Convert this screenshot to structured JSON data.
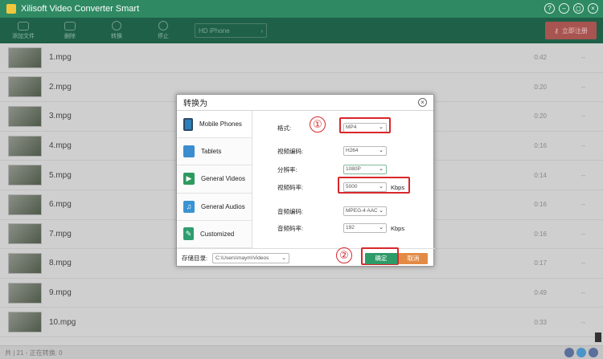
{
  "app": {
    "title": "Xilisoft Video Converter Smart",
    "window_controls": [
      "?",
      "–",
      "◻",
      "×"
    ]
  },
  "toolbar": {
    "buttons": [
      {
        "label": "添加文件",
        "icon": "add-file-icon"
      },
      {
        "label": "删除",
        "icon": "delete-icon"
      },
      {
        "label": "转换",
        "icon": "convert-icon"
      },
      {
        "label": "停止",
        "icon": "stop-icon"
      }
    ],
    "profile": "HD iPhone",
    "register_label": "立即注册"
  },
  "files": [
    {
      "name": "1.mpg",
      "duration": "0:42",
      "dash": "--"
    },
    {
      "name": "2.mpg",
      "duration": "0:20",
      "dash": "--"
    },
    {
      "name": "3.mpg",
      "duration": "0:20",
      "dash": "--"
    },
    {
      "name": "4.mpg",
      "duration": "0:16",
      "dash": "--"
    },
    {
      "name": "5.mpg",
      "duration": "0:14",
      "dash": "--"
    },
    {
      "name": "6.mpg",
      "duration": "0:16",
      "dash": "--"
    },
    {
      "name": "7.mpg",
      "duration": "0:16",
      "dash": "--"
    },
    {
      "name": "8.mpg",
      "duration": "0:17",
      "dash": "--"
    },
    {
      "name": "9.mpg",
      "duration": "0:49",
      "dash": "--"
    },
    {
      "name": "10.mpg",
      "duration": "0:33",
      "dash": "--"
    }
  ],
  "statusbar": {
    "text": "共 | 21 ◦ 正在转换: 0"
  },
  "dialog": {
    "title": "转换为",
    "categories": [
      {
        "label": "Mobile Phones",
        "icon": "mobile-phone-icon"
      },
      {
        "label": "Tablets",
        "icon": "tablet-icon"
      },
      {
        "label": "General Videos",
        "icon": "general-video-icon"
      },
      {
        "label": "General Audios",
        "icon": "music-note-icon"
      },
      {
        "label": "Customized",
        "icon": "customized-icon"
      }
    ],
    "settings": {
      "format_label": "格式:",
      "format_value": "MP4",
      "video_codec_label": "视频编码:",
      "video_codec_value": "H264",
      "resolution_label": "分辨率:",
      "resolution_value": "1080P",
      "video_bitrate_label": "视频码率:",
      "video_bitrate_value": "5000",
      "video_bitrate_unit": "Kbps",
      "audio_codec_label": "音频编码:",
      "audio_codec_value": "MPEG-4 AAC",
      "audio_bitrate_label": "音频码率:",
      "audio_bitrate_value": "192",
      "audio_bitrate_unit": "Kbps"
    },
    "output_label": "存储目录:",
    "output_path": "C:\\Users\\maym\\Videos",
    "ok_label": "确定",
    "cancel_label": "取消",
    "markers": [
      "①",
      "②"
    ]
  }
}
